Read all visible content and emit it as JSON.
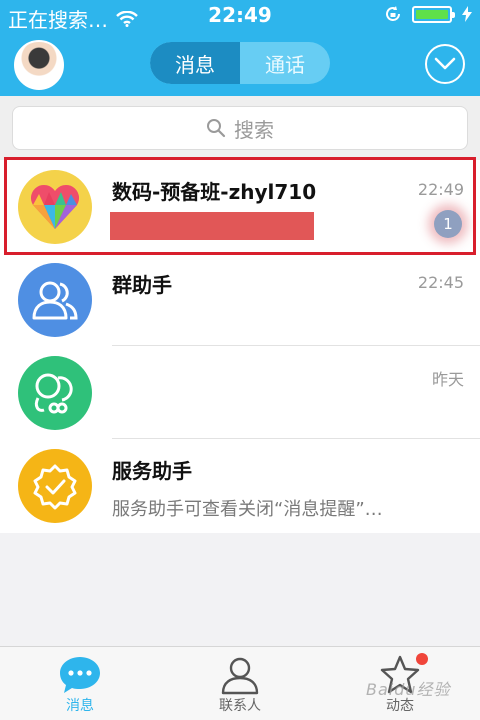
{
  "status_bar": {
    "carrier": "正在搜索…",
    "time": "22:49",
    "wifi_icon": "wifi-icon",
    "rotation_lock_icon": "rotation-lock-icon",
    "battery_icon": "battery-icon",
    "charging_icon": "bolt-icon"
  },
  "header": {
    "tabs": [
      {
        "label": "消息",
        "active": true
      },
      {
        "label": "通话",
        "active": false
      }
    ],
    "menu_icon": "chevron-down-icon"
  },
  "search": {
    "placeholder": "搜索"
  },
  "conversations": [
    {
      "title": "数码-预备班-zhyl710",
      "time": "22:49",
      "subtitle": "",
      "unread": "1",
      "icon": "heart-icon",
      "icon_color": "#f4d24a"
    },
    {
      "title": "群助手",
      "time": "22:45",
      "subtitle": "",
      "icon": "group-icon",
      "icon_color": "#4f8fe3"
    },
    {
      "title": "",
      "time": "昨天",
      "subtitle": "",
      "icon": "contacts-icon",
      "icon_color": "#2fc17a"
    },
    {
      "title": "服务助手",
      "time": "",
      "subtitle": "服务助手可查看关闭“消息提醒”…",
      "icon": "check-badge-icon",
      "icon_color": "#f5b516"
    }
  ],
  "tabbar": [
    {
      "label": "消息",
      "icon": "chat-bubble-icon",
      "active": true
    },
    {
      "label": "联系人",
      "icon": "person-icon",
      "active": false
    },
    {
      "label": "动态",
      "icon": "star-icon",
      "active": false
    }
  ],
  "watermark": "Baidu经验",
  "colors": {
    "brand": "#2eb5ec",
    "highlight_border": "#d81e2c",
    "badge_dot": "#f0453a"
  }
}
